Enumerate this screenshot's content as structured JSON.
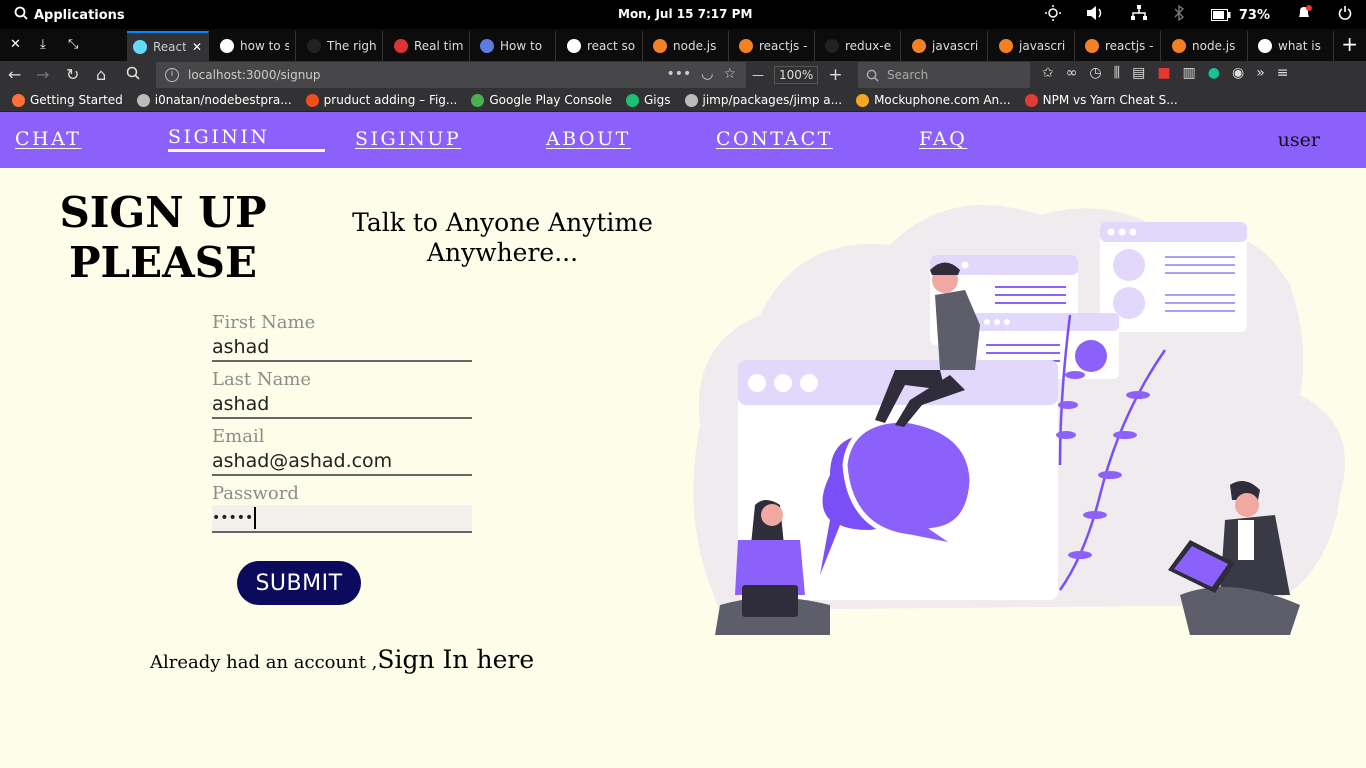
{
  "os": {
    "applications_label": "Applications",
    "clock": "Mon, Jul 15    7:17 PM",
    "battery": "73%"
  },
  "tabs": [
    {
      "title": "React",
      "icon": "react-icon",
      "color": "#61dafb",
      "active": true
    },
    {
      "title": "how to s",
      "icon": "google-icon",
      "color": "#ffffff"
    },
    {
      "title": "The righ",
      "icon": "github-icon",
      "color": "#222222"
    },
    {
      "title": "Real tim",
      "icon": "app-icon",
      "color": "#d33"
    },
    {
      "title": "How to",
      "icon": "site-icon",
      "color": "#5a7ddf"
    },
    {
      "title": "react so",
      "icon": "google-icon",
      "color": "#ffffff"
    },
    {
      "title": "node.js",
      "icon": "stackoverflow-icon",
      "color": "#f48024"
    },
    {
      "title": "reactjs -",
      "icon": "stackoverflow-icon",
      "color": "#f48024"
    },
    {
      "title": "redux-e",
      "icon": "github-icon",
      "color": "#222222"
    },
    {
      "title": "javascri",
      "icon": "stackoverflow-icon",
      "color": "#f48024"
    },
    {
      "title": "javascri",
      "icon": "stackoverflow-icon",
      "color": "#f48024"
    },
    {
      "title": "reactjs -",
      "icon": "stackoverflow-icon",
      "color": "#f48024"
    },
    {
      "title": "node.js",
      "icon": "stackoverflow-icon",
      "color": "#f48024"
    },
    {
      "title": "what is",
      "icon": "google-icon",
      "color": "#ffffff"
    }
  ],
  "navbar": {
    "url": "localhost:3000/signup",
    "zoom": "100%",
    "search_placeholder": "Search"
  },
  "bookmarks": [
    {
      "label": "Getting Started",
      "color": "#ff7139"
    },
    {
      "label": "i0natan/nodebestpra...",
      "color": "#bbbbbb"
    },
    {
      "label": "pruduct adding – Fig...",
      "color": "#f24e1e"
    },
    {
      "label": "Google Play Console",
      "color": "#4caf50"
    },
    {
      "label": "Gigs",
      "color": "#1dbf73"
    },
    {
      "label": "jimp/packages/jimp a...",
      "color": "#bbbbbb"
    },
    {
      "label": "Mockuphone.com An...",
      "color": "#f5a623"
    },
    {
      "label": "NPM vs Yarn Cheat S...",
      "color": "#e53935"
    }
  ],
  "app": {
    "nav": {
      "chat": "CHAT",
      "signin": "SIGININ",
      "signup": "SIGINUP",
      "about": "ABOUT",
      "contact": "CONTACT",
      "faq": "FAQ",
      "user": "user"
    },
    "title_line1": "SIGN UP",
    "title_line2": "PLEASE",
    "tagline_line1": "Talk to Anyone Anytime",
    "tagline_line2": "Anywhere...",
    "form": {
      "first_name_label": "First Name",
      "first_name_value": "ashad",
      "last_name_label": "Last Name",
      "last_name_value": "ashad",
      "email_label": "Email",
      "email_value": "ashad@ashad.com",
      "password_label": "Password",
      "password_value": "•••••",
      "submit_label": "SUBMIT"
    },
    "already_text": "Already had an account ,",
    "signin_link": "Sign In here"
  },
  "colors": {
    "accent": "#8c61fb",
    "page_bg": "#fefde9",
    "submit_bg": "#0b0a5c"
  }
}
